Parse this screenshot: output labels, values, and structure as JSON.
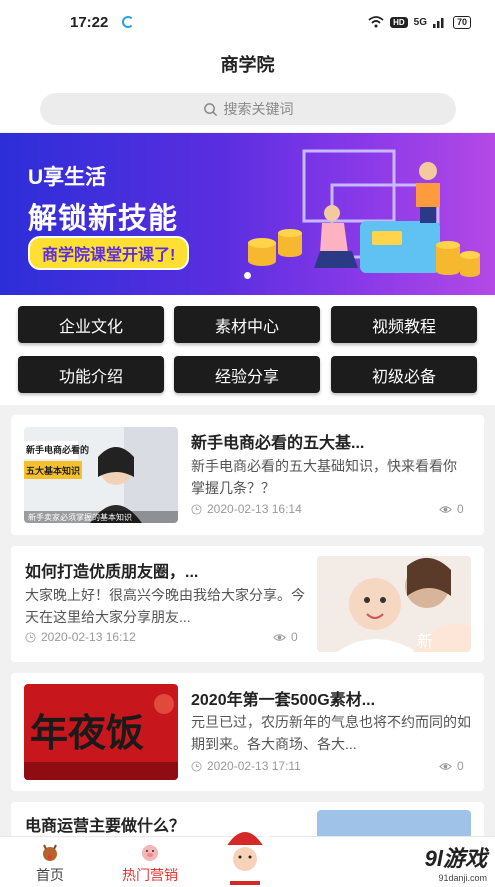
{
  "status": {
    "time": "17:22",
    "battery": "70",
    "network": "5G",
    "hd": "HD"
  },
  "header": {
    "title": "商学院"
  },
  "search": {
    "placeholder": "搜索关键词"
  },
  "banner": {
    "line1": "U享生活",
    "line2": "解锁新技能",
    "pill": "商学院课堂开课了!"
  },
  "categories": [
    "企业文化",
    "素材中心",
    "视频教程",
    "功能介绍",
    "经验分享",
    "初级必备"
  ],
  "articles": [
    {
      "title": "新手电商必看的五大基...",
      "desc": "新手电商必看的五大基础知识，快来看看你掌握几条？？",
      "date": "2020-02-13 16:14",
      "views": "0",
      "thumb_text1": "新手电商必看的",
      "thumb_text2": "五大基本知识",
      "thumb_caption": "新手卖家必须掌握的基本知识"
    },
    {
      "title": "如何打造优质朋友圈，...",
      "desc": "大家晚上好！很高兴今晚由我给大家分享。今天在这里给大家分享朋友...",
      "date": "2020-02-13 16:12",
      "views": "0",
      "thumb_text": "新"
    },
    {
      "title": "2020年第一套500G素材...",
      "desc": "元旦已过，农历新年的气息也将不约而同的如期到来。各大商场、各大...",
      "date": "2020-02-13 17:11",
      "views": "0",
      "thumb_text": "年夜饭"
    },
    {
      "title": "电商运营主要做什么？"
    }
  ],
  "tabs": [
    {
      "label": "首页"
    },
    {
      "label": "热门营销"
    }
  ],
  "watermark": {
    "text": "9l游戏",
    "url": "91danji.com"
  },
  "colors": {
    "accent": "#e53935",
    "banner_start": "#2d2ed8",
    "banner_end": "#b449e6",
    "category_bg": "#1c1c1c"
  }
}
